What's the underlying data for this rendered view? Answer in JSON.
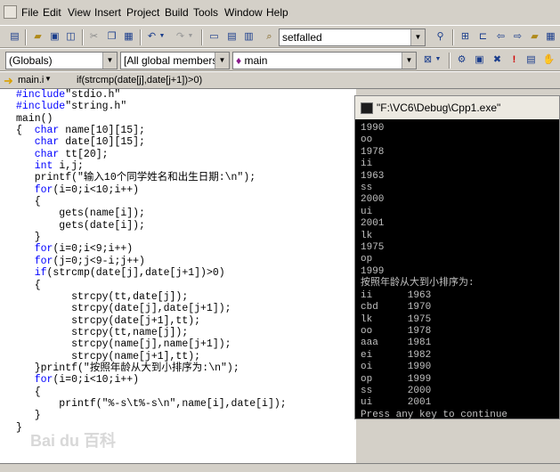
{
  "menu": [
    "File",
    "Edit",
    "View",
    "Insert",
    "Project",
    "Build",
    "Tools",
    "Window",
    "Help"
  ],
  "toolbar": {
    "find_combo": "setfalled"
  },
  "wizardbar": {
    "class_combo": "(Globals)",
    "members_combo": "[All global members",
    "function_combo": "main"
  },
  "navbar": {
    "file_tab": "main.i",
    "condition": "if(strcmp(date[j],date[j+1])>0)"
  },
  "code_lines": [
    "#include\"stdio.h\"",
    "#include\"string.h\"",
    "main()",
    "{  char name[10][15];",
    "   char date[10][15];",
    "   char tt[20];",
    "   int i,j;",
    "   printf(\"输入10个同学姓名和出生日期:\\n\");",
    "   for(i=0;i<10;i++)",
    "   {",
    "       gets(name[i]);",
    "       gets(date[i]);",
    "   }",
    "   for(i=0;i<9;i++)",
    "   for(j=0;j<9-i;j++)",
    "   if(strcmp(date[j],date[j+1])>0)",
    "   {",
    "         strcpy(tt,date[j]);",
    "         strcpy(date[j],date[j+1]);",
    "         strcpy(date[j+1],tt);",
    "         strcpy(tt,name[j]);",
    "         strcpy(name[j],name[j+1]);",
    "         strcpy(name[j+1],tt);",
    "   }printf(\"按照年龄从大到小排序为:\\n\");",
    "   for(i=0;i<10;i++)",
    "   {",
    "       printf(\"%-s\\t%-s\\n\",name[i],date[i]);",
    "   }",
    "}"
  ],
  "console": {
    "title": "\"F:\\VC6\\Debug\\Cpp1.exe\"",
    "lines": [
      "1990",
      "oo",
      "1978",
      "ii",
      "1963",
      "ss",
      "2000",
      "ui",
      "2001",
      "lk",
      "1975",
      "op",
      "1999",
      "按照年龄从大到小排序为:",
      "ii      1963",
      "cbd     1970",
      "lk      1975",
      "oo      1978",
      "aaa     1981",
      "ei      1982",
      "oi      1990",
      "op      1999",
      "ss      2000",
      "ui      2001",
      "Press any key to continue"
    ]
  },
  "watermark": "Bai du 百科"
}
